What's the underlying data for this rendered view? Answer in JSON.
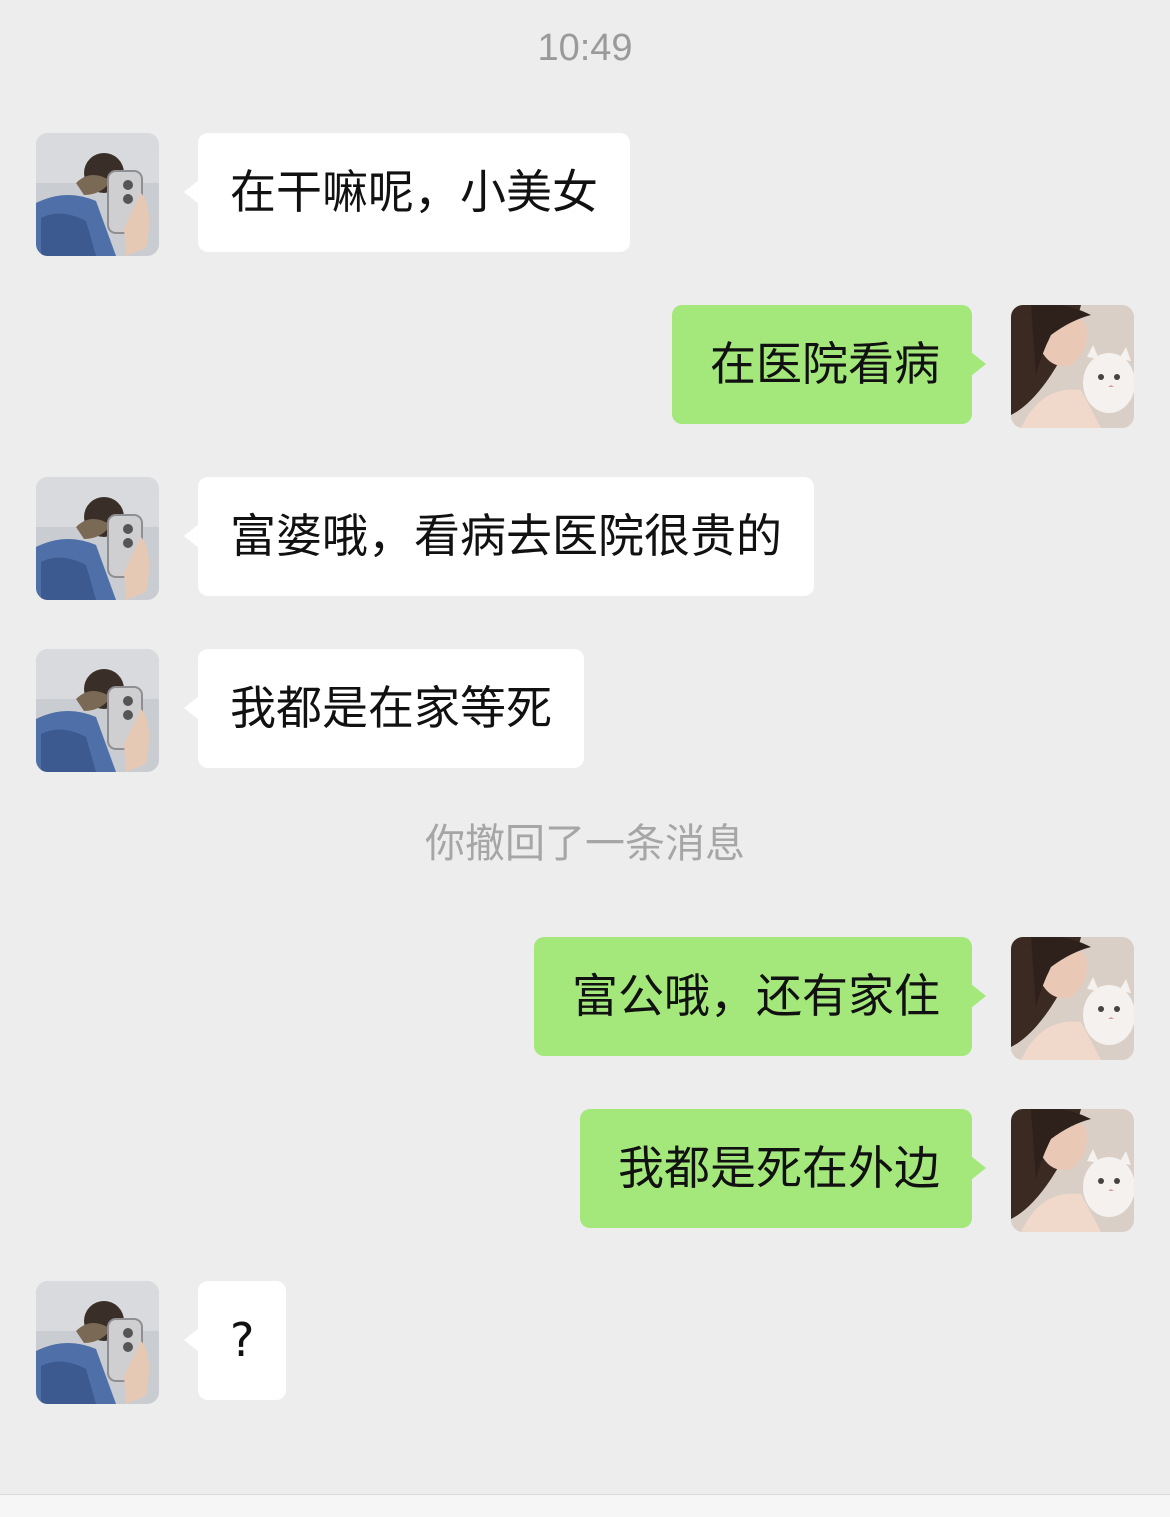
{
  "chat": {
    "timestamp": "10:49",
    "recall_notice": "你撤回了一条消息",
    "messages": [
      {
        "sender": "other",
        "text": "在干嘛呢，小美女"
      },
      {
        "sender": "me",
        "text": "在医院看病"
      },
      {
        "sender": "other",
        "text": "富婆哦，看病去医院很贵的"
      },
      {
        "sender": "other",
        "text": "我都是在家等死"
      },
      {
        "sender": "me",
        "text": "富公哦，还有家住"
      },
      {
        "sender": "me",
        "text": "我都是死在外边"
      },
      {
        "sender": "other",
        "text": "?"
      }
    ]
  },
  "theme": {
    "background": "#ededed",
    "incoming_bubble": "#ffffff",
    "outgoing_bubble": "#a4e87c"
  }
}
